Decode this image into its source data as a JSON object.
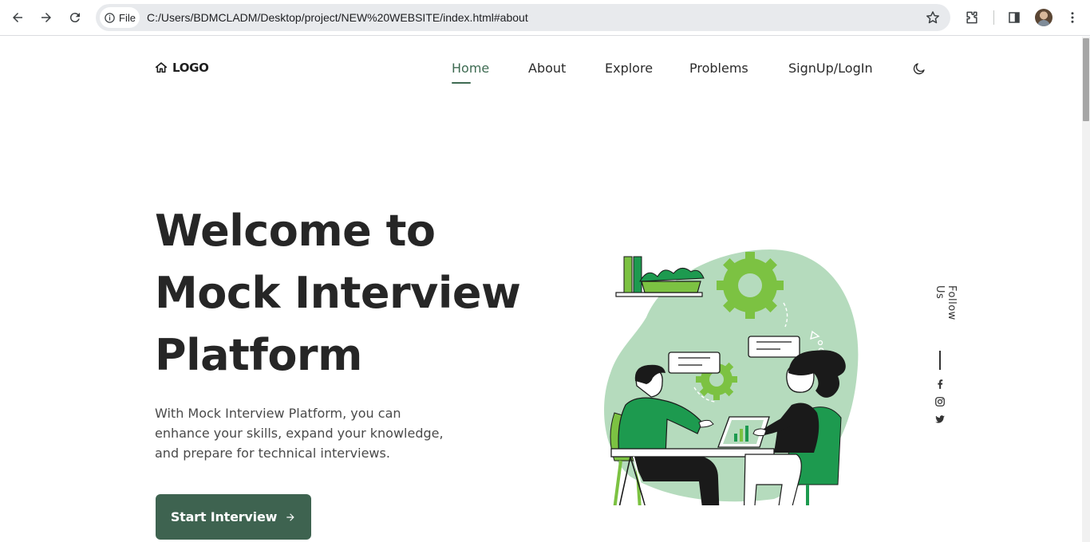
{
  "browser": {
    "site_chip_label": "File",
    "url": "C:/Users/BDMCLADM/Desktop/project/NEW%20WEBSITE/index.html#about",
    "icons": [
      "back-arrow-icon",
      "forward-arrow-icon",
      "reload-icon",
      "info-icon",
      "star-icon",
      "extensions-icon",
      "side-panel-icon",
      "profile-avatar",
      "more-vert-icon"
    ]
  },
  "header": {
    "logo_text": "LOGO",
    "nav": [
      {
        "label": "Home",
        "active": true
      },
      {
        "label": "About"
      },
      {
        "label": "Explore"
      },
      {
        "label": "Problems"
      },
      {
        "label": "SignUp/LogIn"
      }
    ],
    "theme_icon": "moon-icon"
  },
  "hero": {
    "title_lines": [
      "Welcome to",
      "Mock Interview",
      "Platform"
    ],
    "description_lines": [
      "With Mock Interview Platform, you can",
      "enhance your skills, expand your knowledge,",
      "and prepare for technical interviews."
    ],
    "cta_label": "Start Interview",
    "cta_icon": "arrow-right-icon"
  },
  "social": {
    "label": "Follow Us",
    "icons": [
      "facebook-icon",
      "instagram-icon",
      "twitter-icon"
    ]
  },
  "colors": {
    "accent": "#3e6b52",
    "button": "#3e6350",
    "illustration_green": "#1d9a4f",
    "illustration_light": "#b5dbbd",
    "illustration_lime": "#7cc242"
  }
}
